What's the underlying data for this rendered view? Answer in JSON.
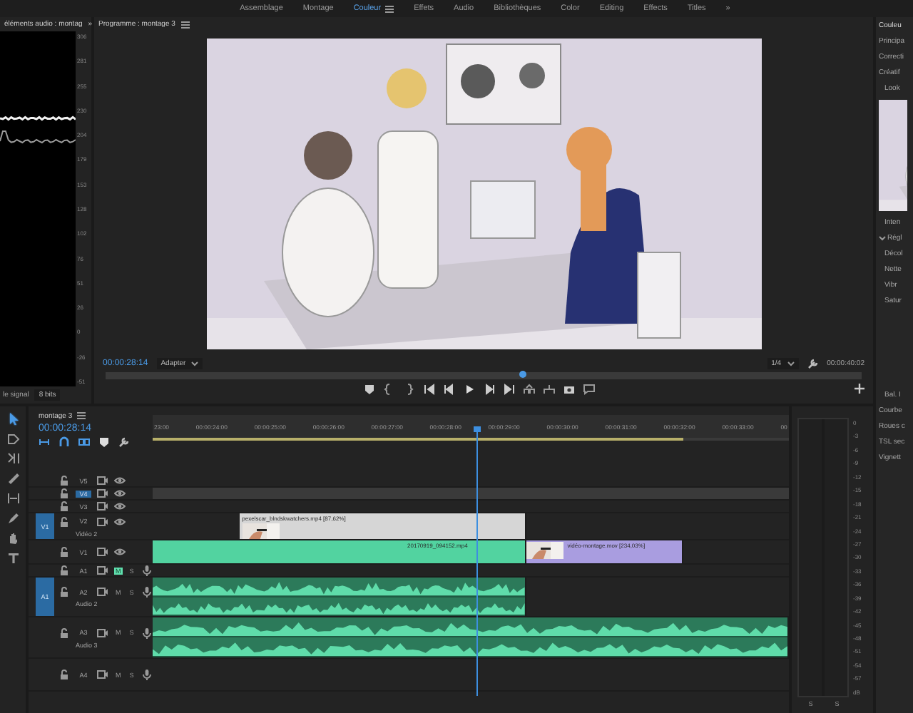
{
  "workspace_tabs": [
    {
      "label": "Assemblage",
      "selected": false
    },
    {
      "label": "Montage",
      "selected": false
    },
    {
      "label": "Couleur",
      "selected": true
    },
    {
      "label": "Effets",
      "selected": false
    },
    {
      "label": "Audio",
      "selected": false
    },
    {
      "label": "Bibliothèques",
      "selected": false
    },
    {
      "label": "Color",
      "selected": false
    },
    {
      "label": "Editing",
      "selected": false
    },
    {
      "label": "Effects",
      "selected": false
    },
    {
      "label": "Titles",
      "selected": false
    }
  ],
  "workspace_overflow": "»",
  "scope_panel": {
    "title": "éléments audio : montag",
    "overflow": "»",
    "scale": [
      "306",
      "281",
      "255",
      "230",
      "204",
      "179",
      "153",
      "128",
      "102",
      "76",
      "51",
      "26",
      "0",
      "-26",
      "-51"
    ],
    "signal_label": "le signal",
    "bit_depth": "8 bits"
  },
  "program_monitor": {
    "title": "Programme : montage 3",
    "timecode": "00:00:28:14",
    "zoom": "Adapter",
    "resolution": "1/4",
    "duration": "00:00:40:02",
    "scrubber": {
      "level": 0.55
    }
  },
  "tools": [
    {
      "kind": "selection",
      "selected": true
    },
    {
      "kind": "track_select",
      "selected": false
    },
    {
      "kind": "ripple",
      "selected": false
    },
    {
      "kind": "razor",
      "selected": false
    },
    {
      "kind": "slip",
      "selected": false
    },
    {
      "kind": "pen",
      "selected": false
    },
    {
      "kind": "hand",
      "selected": false
    },
    {
      "kind": "type",
      "selected": false
    }
  ],
  "timeline": {
    "title": "montage 3",
    "timecode": "00:00:28:14",
    "ruler": [
      "23:00",
      "00:00:24:00",
      "00:00:25:00",
      "00:00:26:00",
      "00:00:27:00",
      "00:00:28:00",
      "00:00:29:00",
      "00:00:30:00",
      "00:00:31:00",
      "00:00:32:00",
      "00:00:33:00",
      "00"
    ],
    "tracks": [
      {
        "name": "V5",
        "kind": "video",
        "targeted": false
      },
      {
        "name": "V4",
        "kind": "video",
        "targeted": true
      },
      {
        "name": "V3",
        "kind": "video",
        "targeted": false
      },
      {
        "name": "V2",
        "kind": "video",
        "targeted": false,
        "label": "Vidéo 2",
        "source": "V1",
        "clips": [
          {
            "kind": "video",
            "label": "pexelscar_blndskwatchers.mp4 [87,62%]",
            "color": "#d6d6d6",
            "thumbnail": true
          }
        ]
      },
      {
        "name": "V1",
        "kind": "video",
        "targeted": false,
        "clips": [
          {
            "kind": "video",
            "label": "20170919_094152.mp4",
            "color": "#52d3a0",
            "thumbnail": false
          },
          {
            "kind": "video",
            "label": "vidéo-montage.mov [234,03%]",
            "color": "#a99de0",
            "thumbnail": true
          }
        ]
      },
      {
        "name": "A1",
        "kind": "audio",
        "targeted": false,
        "muted": true,
        "mute_label": "M",
        "solo_label": "S"
      },
      {
        "name": "A2",
        "kind": "audio",
        "targeted": false,
        "muted": false,
        "mute_label": "M",
        "solo_label": "S",
        "label": "Audio 2",
        "source": "A1",
        "clips": [
          {
            "kind": "audio",
            "color": "#2c7a5a"
          }
        ]
      },
      {
        "name": "A3",
        "kind": "audio",
        "targeted": false,
        "muted": false,
        "mute_label": "M",
        "solo_label": "S",
        "label": "Audio 3",
        "clips": [
          {
            "kind": "audio",
            "color": "#2c7a5a"
          }
        ]
      },
      {
        "name": "A4",
        "kind": "audio",
        "targeted": false,
        "muted": false,
        "mute_label": "M",
        "solo_label": "S"
      }
    ]
  },
  "audio_meter": {
    "scale": [
      "0",
      "-3",
      "-6",
      "-9",
      "-12",
      "-15",
      "-18",
      "-21",
      "-24",
      "-27",
      "-30",
      "-33",
      "-36",
      "-39",
      "-42",
      "-45",
      "-48",
      "-51",
      "-54",
      "-57",
      "dB"
    ],
    "channels": [
      "S",
      "S"
    ]
  },
  "color_panel": {
    "items": [
      {
        "label": "Couleu",
        "kind": "header"
      },
      {
        "label": "Principa",
        "kind": "section"
      },
      {
        "label": "Correcti",
        "kind": "section"
      },
      {
        "label": "Créatif",
        "kind": "section"
      },
      {
        "label": "Look",
        "kind": "look"
      },
      {
        "label": "Inten",
        "kind": "row"
      },
      {
        "label": "Régl",
        "kind": "group"
      },
      {
        "label": "Décol",
        "kind": "row"
      },
      {
        "label": "Nette",
        "kind": "row"
      },
      {
        "label": "Vibr",
        "kind": "row"
      },
      {
        "label": "Satur",
        "kind": "row"
      },
      {
        "label": "Bal. I",
        "kind": "balance"
      },
      {
        "label": "Courbe",
        "kind": "section"
      },
      {
        "label": "Roues c",
        "kind": "section"
      },
      {
        "label": "TSL sec",
        "kind": "section"
      },
      {
        "label": "Vignett",
        "kind": "section"
      }
    ]
  }
}
